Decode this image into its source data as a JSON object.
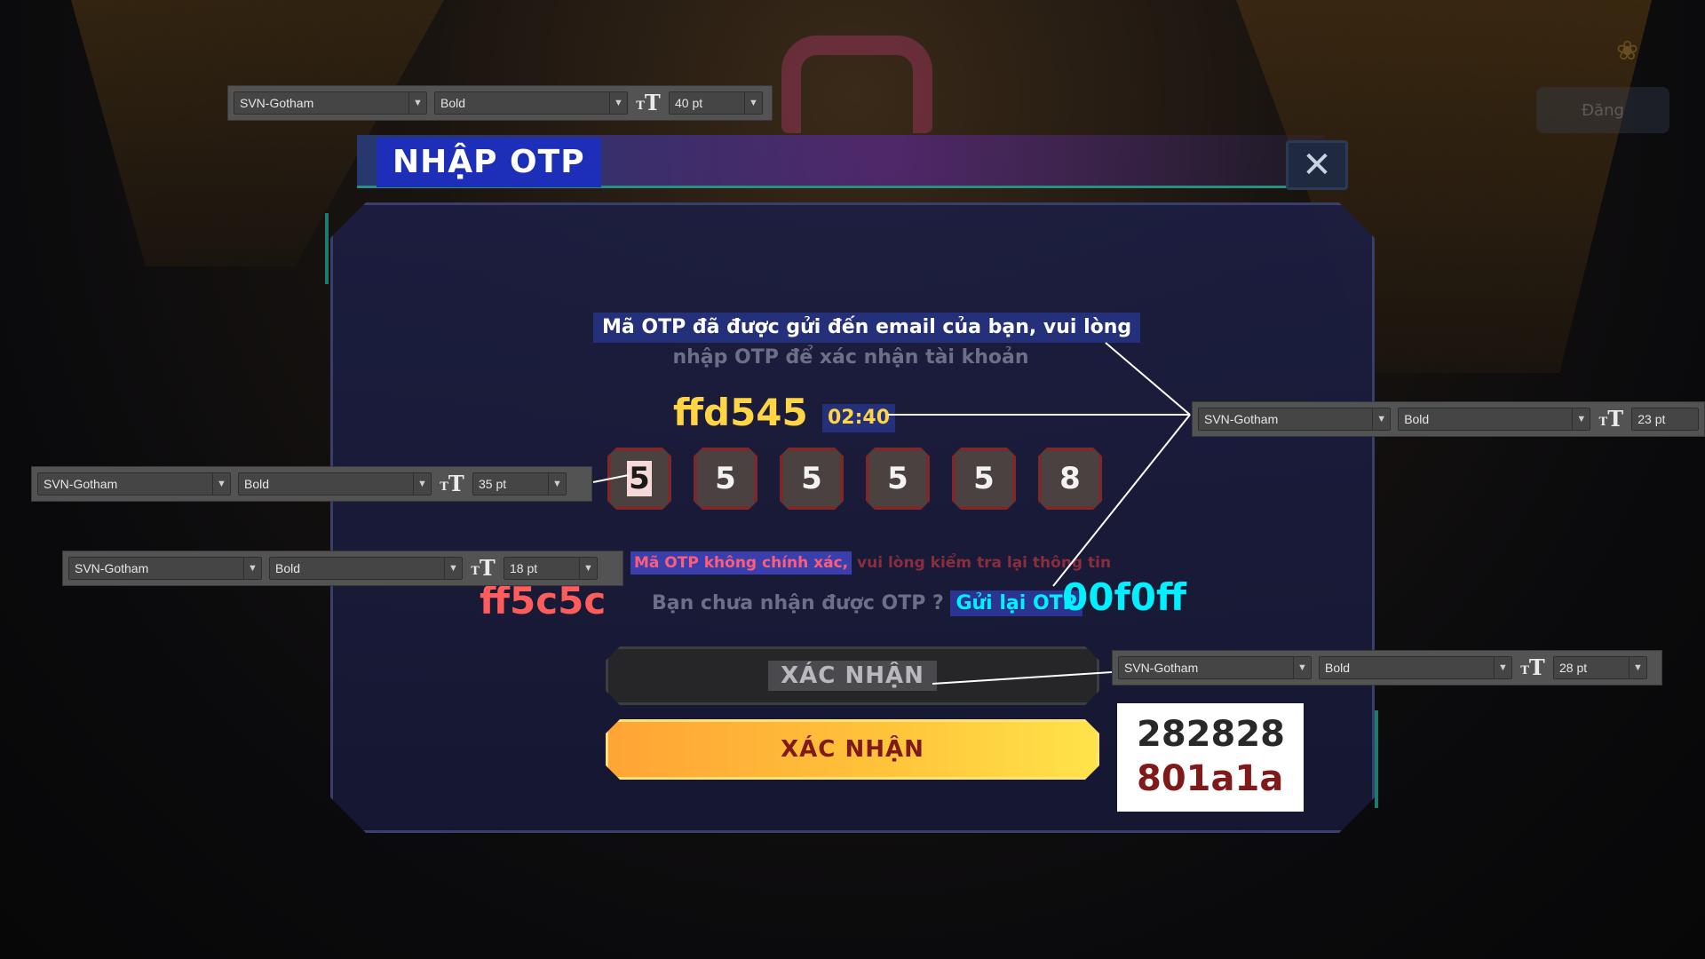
{
  "background": {
    "logo_glyph": "❀",
    "login_label": "Đăng"
  },
  "dialog": {
    "title": "NHẬP OTP",
    "close_label": "✕",
    "message_line1": "Mã OTP đã được gửi đến email của bạn, vui lòng",
    "message_line2": "nhập OTP để xác nhận tài khoản",
    "timer": "02:40",
    "otp_digits": [
      "5",
      "5",
      "5",
      "5",
      "5",
      "8"
    ],
    "error_highlight": "Mã OTP không chính xác,",
    "error_rest": " vui lòng kiểm tra lại thông tin",
    "resend_prompt": "Bạn chưa nhận được OTP ? ",
    "resend_link": "Gửi lại OTP",
    "confirm_disabled_label": "XÁC NHẬN",
    "confirm_active_label": "XÁC NHẬN"
  },
  "annotations": {
    "color_yellow": "ffd545",
    "color_red": "ff5c5c",
    "color_cyan": "00f0ff",
    "swatch_dark": "282828",
    "swatch_red": "801a1a"
  },
  "toolbars": [
    {
      "font": "SVN-Gotham",
      "weight": "Bold",
      "size": "40 pt"
    },
    {
      "font": "SVN-Gotham",
      "weight": "Bold",
      "size": "23 pt"
    },
    {
      "font": "SVN-Gotham",
      "weight": "Bold",
      "size": "35 pt"
    },
    {
      "font": "SVN-Gotham",
      "weight": "Bold",
      "size": "18 pt"
    },
    {
      "font": "SVN-Gotham",
      "weight": "Bold",
      "size": "28 pt"
    }
  ],
  "colors": {
    "title_bg": "#1d2fb8",
    "accent_teal": "#2a8f80",
    "otp_box": "#4b4141",
    "otp_border": "#7a2a2a",
    "button_gradient_start": "#ffa435",
    "button_gradient_end": "#ffe34a"
  }
}
